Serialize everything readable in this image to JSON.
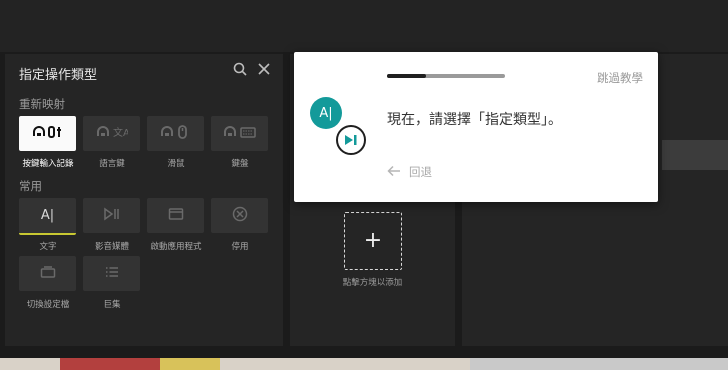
{
  "panel": {
    "title": "指定操作類型",
    "section_remap": "重新映射",
    "section_common": "常用",
    "remap_items": [
      {
        "label": "按鍵輸入記錄",
        "icon": "keystroke-record-icon",
        "selected": true
      },
      {
        "label": "語言鍵",
        "icon": "language-key-icon",
        "selected": false
      },
      {
        "label": "滑鼠",
        "icon": "mouse-icon",
        "selected": false
      },
      {
        "label": "鍵盤",
        "icon": "keyboard-icon",
        "selected": false
      }
    ],
    "common_items": [
      {
        "label": "文字",
        "icon": "text-icon",
        "symbol": "A|"
      },
      {
        "label": "影音媒體",
        "icon": "media-play-icon",
        "symbol": "▷||"
      },
      {
        "label": "啟動應用程式",
        "icon": "app-window-icon",
        "symbol": ""
      },
      {
        "label": "停用",
        "icon": "disable-icon",
        "symbol": "⊗"
      },
      {
        "label": "切換設定檔",
        "icon": "switch-profile-icon",
        "symbol": ""
      },
      {
        "label": "巨集",
        "icon": "macro-list-icon",
        "symbol": ""
      }
    ]
  },
  "middle": {
    "add_label": "點擊方塊以添加",
    "add_symbol": "+"
  },
  "tutorial": {
    "skip_label": "跳過教學",
    "progress": 0.33,
    "avatar_text": "A|",
    "message": "現在，請選擇「指定類型」。",
    "back_label": "回退"
  },
  "colors": {
    "accent_teal": "#139a9a",
    "selected_underline": "#c8c832"
  }
}
